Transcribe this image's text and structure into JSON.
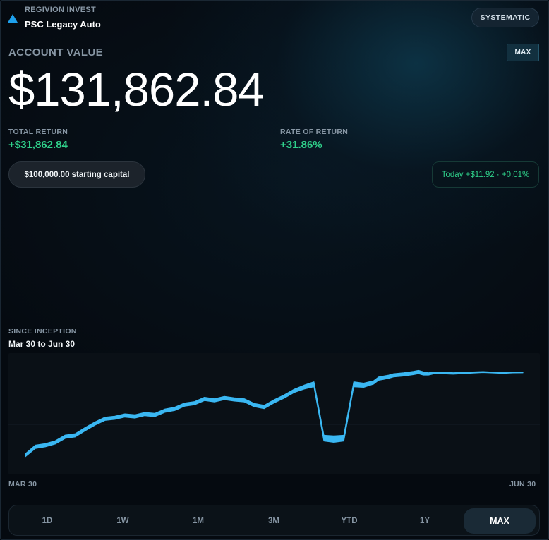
{
  "header": {
    "brand": "REGIVION INVEST",
    "brand_icon": "triangle-logo-icon",
    "strategy": "PSC Legacy Auto",
    "style_pill": "SYSTEMATIC"
  },
  "account": {
    "label": "ACCOUNT VALUE",
    "value": "$131,862.84",
    "range_toggle": "MAX"
  },
  "metrics": {
    "total_return_label": "TOTAL RETURN",
    "total_return_value": "+$31,862.84",
    "ror_label": "RATE OF RETURN",
    "ror_value": "+31.86%"
  },
  "capital_pill": "$100,000.00 starting capital",
  "today_pill": "Today +$11.92 · +0.01%",
  "chart_section": {
    "title": "SINCE INCEPTION",
    "range": "Mar 30 to Jun 30",
    "x_start": "MAR 30",
    "x_end": "JUN 30"
  },
  "colors": {
    "accent": "#1ea0ec",
    "positive": "#2fd08a",
    "line": "#3ab7f2",
    "background": "#050a10"
  },
  "chart_data": {
    "type": "area",
    "x": [
      0,
      2,
      4,
      6,
      8,
      10,
      12,
      14,
      16,
      18,
      20,
      22,
      24,
      26,
      28,
      30,
      32,
      34,
      36,
      38,
      40,
      42,
      44,
      46,
      48,
      50,
      52,
      54,
      56,
      58,
      60,
      62,
      64,
      66,
      68,
      70,
      71,
      72,
      73,
      74,
      76,
      78,
      79,
      80,
      81,
      82,
      84,
      86,
      88,
      90,
      92,
      94,
      96,
      98,
      100
    ],
    "values": [
      100000,
      100880,
      101050,
      101350,
      101950,
      102100,
      102750,
      103350,
      103850,
      103960,
      104200,
      104100,
      104350,
      104250,
      104700,
      104900,
      105350,
      105500,
      105950,
      105800,
      106050,
      105900,
      105800,
      105300,
      105100,
      105700,
      106200,
      106800,
      107200,
      107500,
      101800,
      101700,
      101800,
      107500,
      107400,
      107700,
      108100,
      108200,
      108300,
      108450,
      108550,
      108700,
      108800,
      108650,
      108600,
      108700,
      108700,
      108650,
      108700,
      108750,
      108800,
      108750,
      108700,
      108750,
      108750
    ],
    "band_half_width": [
      150,
      170,
      170,
      170,
      170,
      170,
      170,
      170,
      170,
      170,
      170,
      170,
      170,
      170,
      170,
      170,
      170,
      170,
      170,
      170,
      170,
      170,
      170,
      170,
      170,
      170,
      170,
      170,
      200,
      260,
      300,
      340,
      300,
      260,
      220,
      170,
      170,
      170,
      170,
      170,
      170,
      170,
      170,
      170,
      120,
      100,
      90,
      80,
      70,
      60,
      50,
      45,
      40,
      35,
      30
    ],
    "ylim": [
      99000,
      110200
    ],
    "grid": false
  },
  "range_tabs": [
    "1D",
    "1W",
    "1M",
    "3M",
    "YTD",
    "1Y",
    "MAX"
  ],
  "active_tab": 6
}
